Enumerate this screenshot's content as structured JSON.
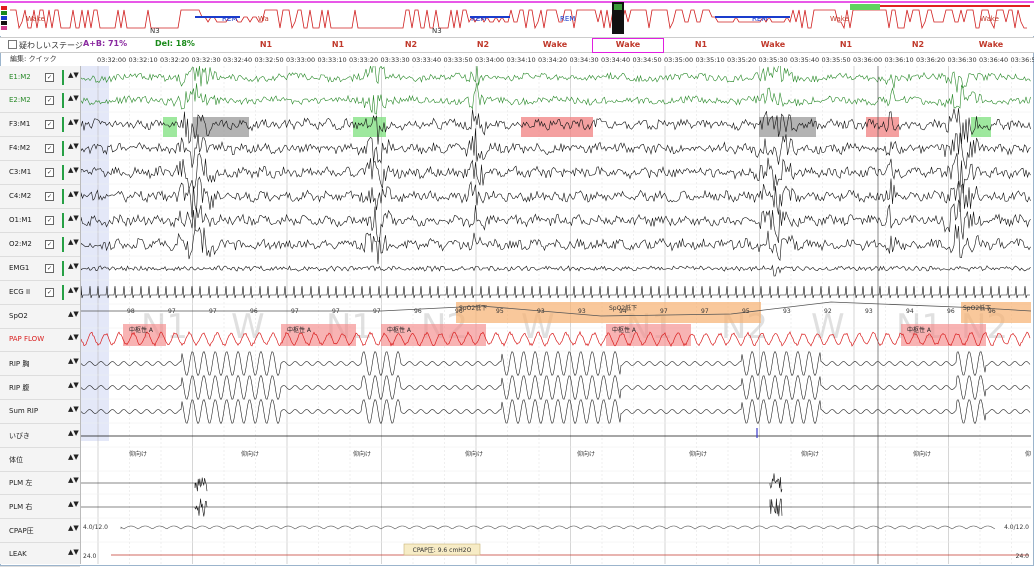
{
  "hypnogram": {
    "labels": [
      {
        "text": "Wake",
        "color": "#c0392b"
      },
      {
        "text": "N3",
        "color": "#333"
      },
      {
        "text": "REM",
        "color": "#1a3ccc"
      },
      {
        "text": "Wa",
        "color": "#c0392b"
      },
      {
        "text": "N3",
        "color": "#333"
      },
      {
        "text": "REM",
        "color": "#1a3ccc"
      },
      {
        "text": "REM",
        "color": "#1a3ccc"
      },
      {
        "text": "REM",
        "color": "#1a3ccc"
      },
      {
        "text": "Wake",
        "color": "#c0392b"
      },
      {
        "text": "Wake",
        "color": "#c0392b"
      }
    ]
  },
  "stagebar": {
    "checkbox_label": "疑わしいステージ",
    "ab_score": "A+B: 71%",
    "del_score": "Del: 18%",
    "epochs": [
      "N1",
      "N1",
      "N2",
      "N2",
      "Wake",
      "Wake",
      "N1",
      "Wake",
      "N1",
      "N2",
      "Wake"
    ]
  },
  "timebar": {
    "edit_label": "編集: クイック",
    "times": [
      "03:32:00",
      "03:32:10",
      "03:32:20",
      "03:32:30",
      "03:32:40",
      "03:32:50",
      "03:33:00",
      "03:33:10",
      "03:33:20",
      "03:33:30",
      "03:33:40",
      "03:33:50",
      "03:34:00",
      "03:34:10",
      "03:34:20",
      "03:34:30",
      "03:34:40",
      "03:34:50",
      "03:35:00",
      "03:35:10",
      "03:35:20",
      "03:35:30",
      "03:35:40",
      "03:35:50",
      "03:36:00",
      "03:36:10",
      "03:36:20",
      "03:36:30",
      "03:36:40",
      "03:36:50"
    ]
  },
  "channels": [
    {
      "name": "E1:M2",
      "color": "#2a8a2a",
      "checked": true
    },
    {
      "name": "E2:M2",
      "color": "#2a8a2a",
      "checked": true
    },
    {
      "name": "F3:M1",
      "color": "#222",
      "checked": true
    },
    {
      "name": "F4:M2",
      "color": "#222",
      "checked": true
    },
    {
      "name": "C3:M1",
      "color": "#222",
      "checked": true
    },
    {
      "name": "C4:M2",
      "color": "#222",
      "checked": true
    },
    {
      "name": "O1:M1",
      "color": "#222",
      "checked": true
    },
    {
      "name": "O2:M2",
      "color": "#222",
      "checked": true
    },
    {
      "name": "EMG1",
      "color": "#222",
      "checked": true
    },
    {
      "name": "ECG II",
      "color": "#222",
      "checked": true
    },
    {
      "name": "SpO2",
      "color": "#222",
      "checked": false
    },
    {
      "name": "PAP FLOW",
      "color": "#d92020",
      "checked": false
    },
    {
      "name": "RIP 胸",
      "color": "#222",
      "checked": false
    },
    {
      "name": "RIP 腹",
      "color": "#222",
      "checked": false
    },
    {
      "name": "Sum RIP",
      "color": "#222",
      "checked": false
    },
    {
      "name": "いびき",
      "color": "#222",
      "checked": false
    },
    {
      "name": "体位",
      "color": "#222",
      "checked": false
    },
    {
      "name": "PLM 左",
      "color": "#222",
      "checked": false
    },
    {
      "name": "PLM 右",
      "color": "#222",
      "checked": false
    },
    {
      "name": "CPAP圧",
      "color": "#222",
      "checked": false
    },
    {
      "name": "LEAK",
      "color": "#222",
      "checked": false
    }
  ],
  "events": {
    "arousal_labels": [
      "覚醒",
      "覚醒",
      "覚醒",
      "覚醒"
    ],
    "apnea_labels": [
      "中枢性 A",
      "中枢性 A",
      "中枢性 A",
      "中枢性 A",
      "中枢性 A"
    ],
    "desat_labels": [
      "SpO2低下",
      "SpO2低下",
      "SpO2低下"
    ],
    "spo2_values": [
      "98",
      "97",
      "97",
      "96",
      "97",
      "97",
      "97",
      "96",
      "96",
      "95",
      "93",
      "93",
      "94",
      "97",
      "97",
      "95",
      "93",
      "92",
      "93",
      "94",
      "96",
      "96"
    ],
    "watermark_stages": [
      "N1",
      "W",
      "N1",
      "N2",
      "W",
      "N1",
      "N2",
      "W",
      "N1",
      "N2"
    ],
    "position_labels": [
      "仰向け",
      "仰向け",
      "仰向け",
      "仰向け",
      "仰向け",
      "仰向け",
      "仰向け",
      "仰向け",
      "仰向け"
    ],
    "cpap_left": "4.0/12.0",
    "cpap_right": "4.0/12.0",
    "leak_left": "24.0",
    "leak_right": "24.0",
    "cpap_tooltip": "CPAP圧: 9.6 cmH2O"
  }
}
